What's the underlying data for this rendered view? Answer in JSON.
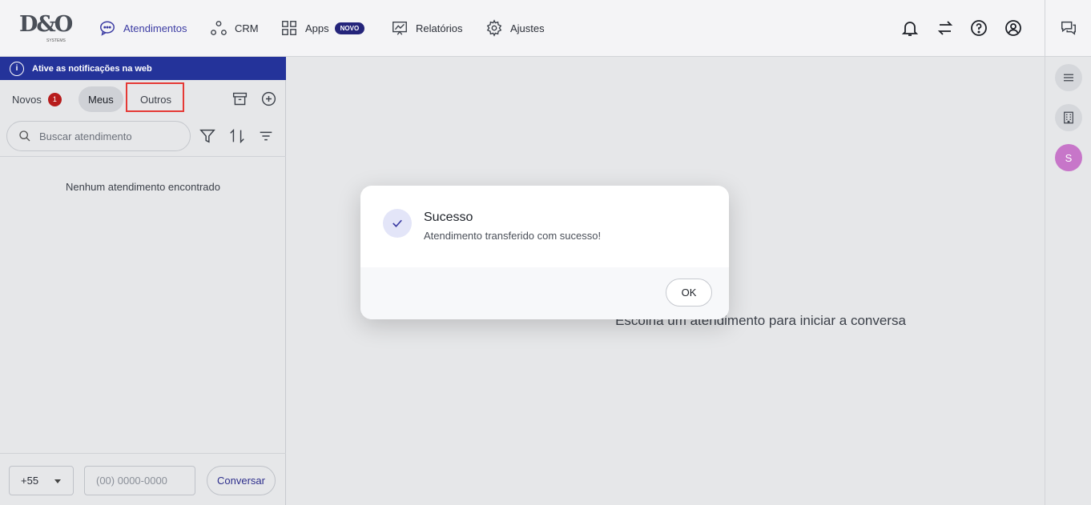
{
  "nav": {
    "items": [
      {
        "label": "Atendimentos",
        "icon": "chat-bubble-icon",
        "active": true
      },
      {
        "label": "CRM",
        "icon": "crm-nodes-icon"
      },
      {
        "label": "Apps",
        "icon": "apps-grid-icon",
        "badge": "NOVO"
      },
      {
        "label": "Relatórios",
        "icon": "report-chart-icon"
      },
      {
        "label": "Ajustes",
        "icon": "gear-icon"
      }
    ],
    "logo_text": "D&O",
    "logo_sub": "SYSTEMS"
  },
  "notification_bar": {
    "text": "Ative as notificações na web"
  },
  "tabs": {
    "novos": {
      "label": "Novos",
      "count": "1"
    },
    "meus": {
      "label": "Meus"
    },
    "outros": {
      "label": "Outros"
    }
  },
  "search": {
    "placeholder": "Buscar atendimento"
  },
  "empty_state": "Nenhum atendimento encontrado",
  "composer": {
    "country_code": "+55",
    "phone_placeholder": "(00) 0000-0000",
    "start_button": "Conversar"
  },
  "main_message": "Escolha um atendimento para iniciar a conversa",
  "rail": {
    "avatar_initial": "S"
  },
  "modal": {
    "title": "Sucesso",
    "message": "Atendimento transferido com sucesso!",
    "ok_label": "OK"
  },
  "colors": {
    "accent": "#3b3ba3",
    "notif_bar": "#24339a",
    "badge_red": "#b71c1c",
    "highlight_box": "#e53935"
  }
}
